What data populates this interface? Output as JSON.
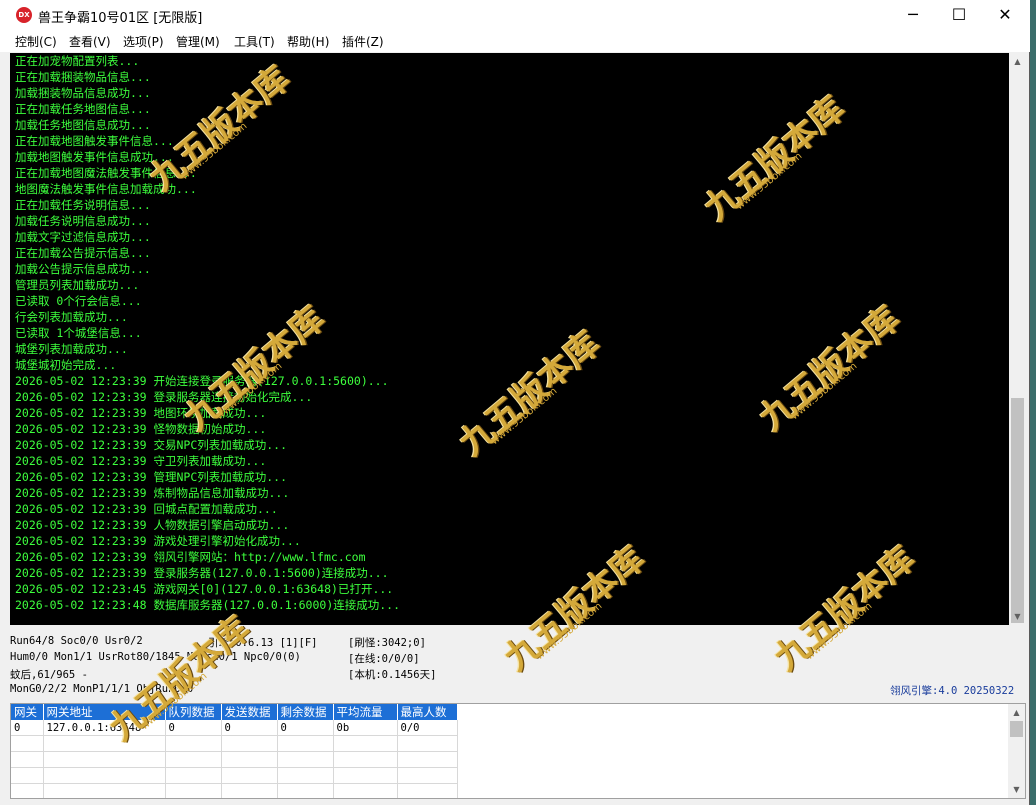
{
  "window": {
    "app_icon_text": "DX",
    "title": "兽王争霸10号01区 [无限版]",
    "minimize": "─",
    "maximize": "☐",
    "close": "✕"
  },
  "menu": [
    "控制(C)",
    "查看(V)",
    "选项(P)",
    "管理(M)",
    "工具(T)",
    "帮助(H)",
    "插件(Z)"
  ],
  "log": [
    "正在加宠物配置列表...",
    "正在加载捆装物品信息...",
    "加载捆装物品信息成功...",
    "正在加载任务地图信息...",
    "加载任务地图信息成功...",
    "正在加载地图触发事件信息...",
    "加载地图触发事件信息成功...",
    "正在加载地图魔法触发事件信息...",
    "地图魔法触发事件信息加载成功...",
    "正在加载任务说明信息...",
    "加载任务说明信息成功...",
    "加载文字过滤信息成功...",
    "正在加载公告提示信息...",
    "加载公告提示信息成功...",
    "管理员列表加载成功...",
    "已读取 0个行会信息...",
    "行会列表加载成功...",
    "已读取 1个城堡信息...",
    "城堡列表加载成功...",
    "城堡城初始完成...",
    "2026-05-02 12:23:39 开始连接登录服务器(127.0.0.1:5600)...",
    "2026-05-02 12:23:39 登录服务器连接初始化完成...",
    "2026-05-02 12:23:39 地图环境加载成功...",
    "2026-05-02 12:23:39 怪物数据初始成功...",
    "2026-05-02 12:23:39 交易NPC列表加载成功...",
    "2026-05-02 12:23:39 守卫列表加载成功...",
    "2026-05-02 12:23:39 管理NPC列表加载成功...",
    "2026-05-02 12:23:39 炼制物品信息加载成功...",
    "2026-05-02 12:23:39 回城点配置加载成功...",
    "2026-05-02 12:23:39 人物数据引擎启动成功...",
    "2026-05-02 12:23:39 游戏处理引擎初始化成功...",
    "2026-05-02 12:23:39 翎风引擎网站：http://www.lfmc.com",
    "2026-05-02 12:23:39 登录服务器(127.0.0.1:5600)连接成功...",
    "2026-05-02 12:23:45 游戏网关[0](127.0.0.1:63648)已打开...",
    "2026-05-02 12:23:48 数据库服务器(127.0.0.1:6000)连接成功..."
  ],
  "status": {
    "line1": "Run64/8 Soc0/0 Usr0/2",
    "engine": "引擎:0.6.13 [1][F]",
    "refresh": "[刷怪:3042;0]",
    "line2": "Hum0/0 Mon1/1 UsrRot80/1845 Merch0/1 Npc0/0(0)",
    "online": "[在线:0/0/0]",
    "line3": "蚊后,61/965 -",
    "local": "[本机:0.1456天]",
    "line4": "MonG0/2/2 MonP1/1/1 ObjRun0/0",
    "version": "翎风引擎:4.0 20250322"
  },
  "grid": {
    "headers": [
      "网关",
      "网关地址",
      "队列数据",
      "发送数据",
      "剩余数据",
      "平均流量",
      "最高人数"
    ],
    "rows": [
      [
        "0",
        "127.0.0.1:63648",
        "0",
        "0",
        "0",
        "0b",
        "0/0"
      ]
    ]
  },
  "watermark": {
    "text": "九五版本库",
    "url": "www.95bbk.com"
  }
}
